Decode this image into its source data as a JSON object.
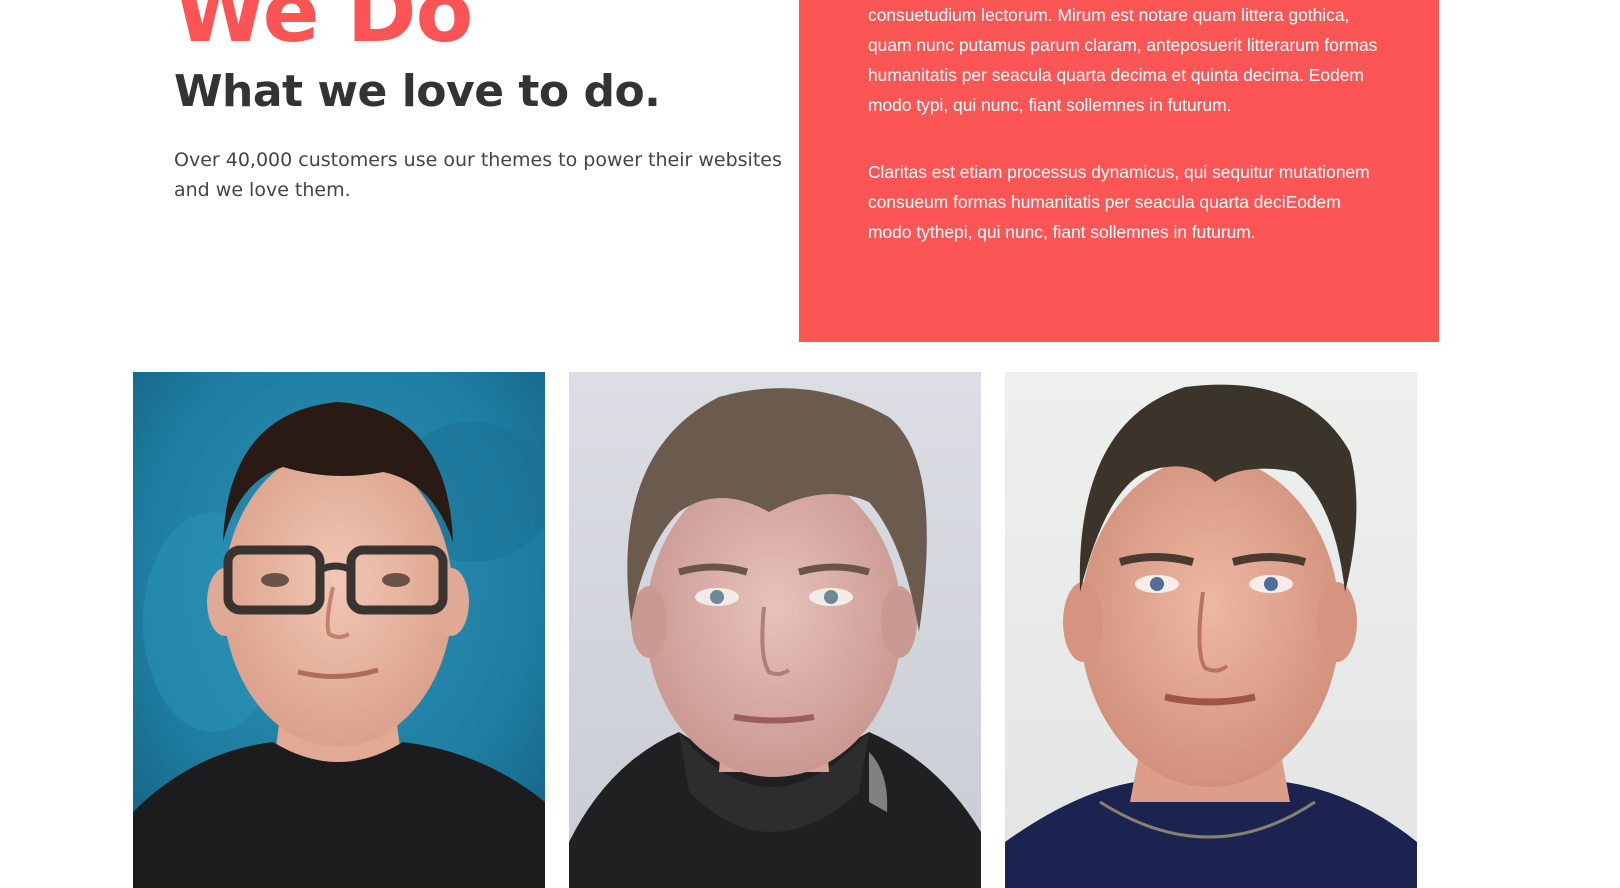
{
  "intro": {
    "title": "We Do",
    "subtitle": "What we love to do.",
    "text": "Over 40,000 customers use our themes to power their websites and we love them."
  },
  "coral_box": {
    "paragraph_1": "consuetudium lectorum. Mirum est notare quam littera gothica, quam nunc putamus parum claram, anteposuerit litterarum formas humanitatis per seacula quarta decima et quinta decima. Eodem modo typi, qui nunc, fiant sollemnes in futurum.",
    "paragraph_2": "Claritas est etiam processus dynamicus, qui sequitur mutationem consueum formas humanitatis per seacula quarta deciEodem modo tythepi, qui nunc, fiant sollemnes in futurum."
  },
  "photos": [
    {
      "icon": "portrait-photo-1"
    },
    {
      "icon": "portrait-photo-2"
    },
    {
      "icon": "portrait-photo-3"
    }
  ],
  "colors": {
    "accent": "#fb5454",
    "heading": "#333333",
    "body_text": "#444444",
    "box_text": "#ffffff"
  }
}
